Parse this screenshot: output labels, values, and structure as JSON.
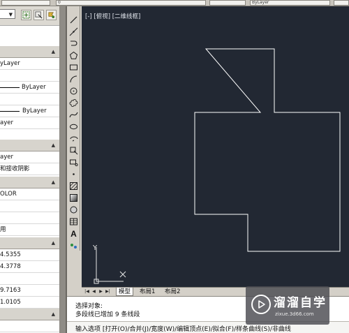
{
  "topbar": {
    "layer_value": "0",
    "linetype_value": "ByLayer"
  },
  "properties": {
    "general": {
      "color": "yLayer",
      "layer": "0",
      "linetype": "ByLayer",
      "linetype_scale": "1",
      "lineweight": "ByLayer",
      "thickness": "ayer"
    },
    "material": "ayer",
    "shadow": "和接收阴影",
    "plot_style": "OLOR",
    "use_label": "用",
    "view": {
      "center_x": "4.5355",
      "center_y": "4.3778",
      "height": "9.7163",
      "width": "1.0105"
    }
  },
  "draw_tools": [
    "line-icon",
    "construction-line-icon",
    "polyline-icon",
    "polygon-icon",
    "rectangle-icon",
    "arc-icon",
    "circle-icon",
    "revision-cloud-icon",
    "spline-icon",
    "ellipse-icon",
    "ellipse-arc-icon",
    "insert-block-icon",
    "make-block-icon",
    "point-icon",
    "hatch-icon",
    "gradient-icon",
    "region-icon",
    "table-icon",
    "mtext-icon",
    "add-selected-icon"
  ],
  "viewport": {
    "label": "[-] [俯视] [二维线框]",
    "ucs_y": "Y",
    "ucs_x": "X"
  },
  "layout_tabs": {
    "model": "模型",
    "layout1": "布局1",
    "layout2": "布局2"
  },
  "command": {
    "line1": "选择对象:",
    "line2": "多段线已增加 9 条线段",
    "prompt": "输入选项 [打开(O)/合并(J)/宽度(W)/编辑顶点(E)/拟合(F)/样条曲线(S)/非曲线"
  },
  "watermark": {
    "title": "溜溜自学",
    "url": "zixue.3d66.com"
  },
  "colors": {
    "canvas_bg": "#222833",
    "drawing_stroke": "#ffffff",
    "panel_bg": "#d4d0c8"
  }
}
